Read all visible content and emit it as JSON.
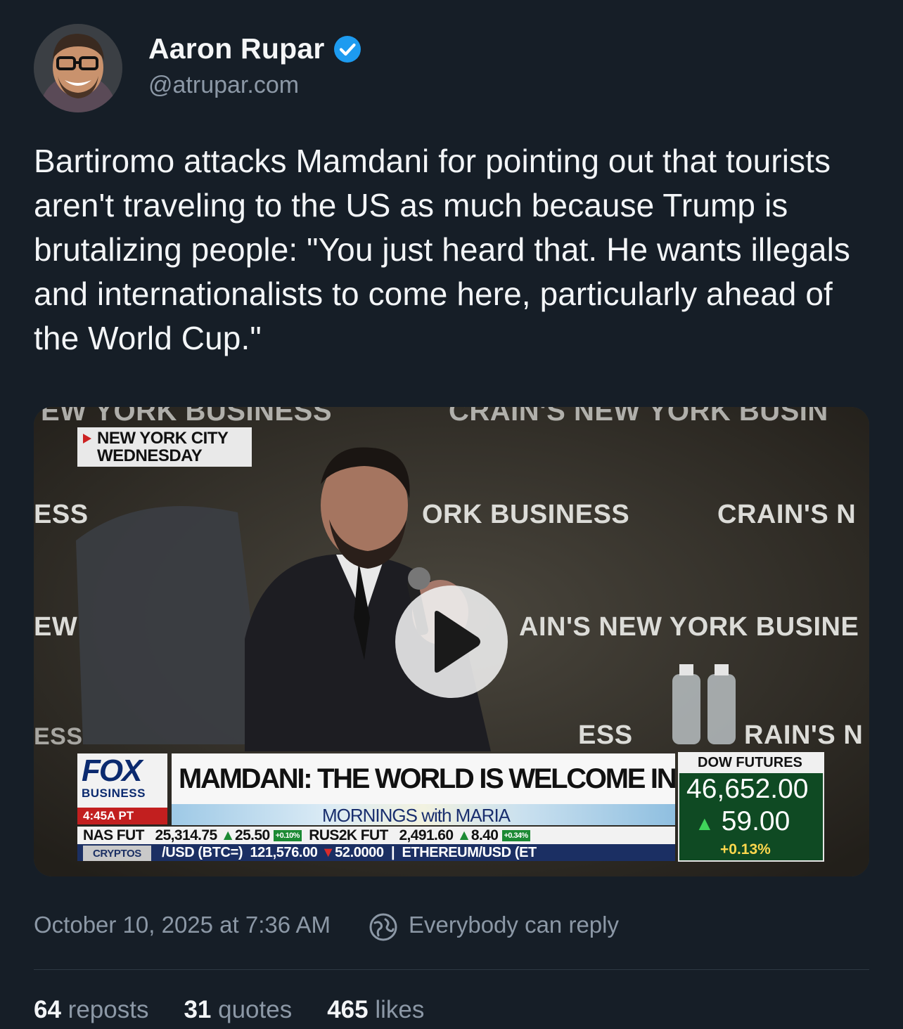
{
  "author": {
    "display_name": "Aaron Rupar",
    "handle": "@atrupar.com",
    "verified": true,
    "avatar_icon": "avatar-photo"
  },
  "post": {
    "text": "Bartiromo attacks Mamdani for pointing out that tourists aren't traveling to the US as much because Trump is brutalizing people: \"You just heard that. He wants illegals and internationalists to come here, particularly ahead of the World Cup.\""
  },
  "video": {
    "backdrop_text": {
      "top_left": "EW YORK BUSINESS",
      "top_right": "CRAIN'S NEW YORK BUSIN",
      "row2_left": "ESS",
      "row2_center": "ORK BUSINESS",
      "row2_right": "CRAIN'S N",
      "row3_left": "EW",
      "row3_right": "AIN'S NEW YORK BUSINE",
      "row4_left": "ESS",
      "row4_center": "ESS",
      "row4_right": "RAIN'S N"
    },
    "location_tag": {
      "line1": "NEW YORK CITY",
      "line2": "WEDNESDAY"
    },
    "play_icon": "play-icon",
    "lower_third": {
      "network": "FOX",
      "network_sub": "BUSINESS",
      "time": "4:45A PT",
      "headline": "MAMDANI: THE WORLD IS WELCOME IN THIS CITY",
      "show": "MORNINGS with MARIA",
      "dow_label": "DOW FUTURES",
      "dow_value": "46,652.00",
      "dow_change": "59.00",
      "dow_pct": "+0.13%",
      "ticker_row1": {
        "nas_label": "NAS FUT",
        "nas_value": "25,314.75",
        "nas_change": "25.50",
        "nas_pct": "+0.10%",
        "rus_label": "RUS2K FUT",
        "rus_value": "2,491.60",
        "rus_change": "8.40",
        "rus_pct": "+0.34%"
      },
      "ticker_row2": {
        "tag": "CRYPTOS",
        "pair": "/USD (BTC=)",
        "value": "121,576.00",
        "change": "52.0000",
        "next": "ETHEREUM/USD (ET"
      }
    }
  },
  "meta": {
    "timestamp": "October 10, 2025 at 7:36 AM",
    "reply_setting": "Everybody can reply",
    "reply_icon": "globe-reply-icon"
  },
  "stats": {
    "reposts_count": "64",
    "reposts_label": "reposts",
    "quotes_count": "31",
    "quotes_label": "quotes",
    "likes_count": "465",
    "likes_label": "likes"
  },
  "colors": {
    "background": "#161e27",
    "secondary_text": "#8c98a6",
    "verified_blue": "#1d9bf0"
  }
}
